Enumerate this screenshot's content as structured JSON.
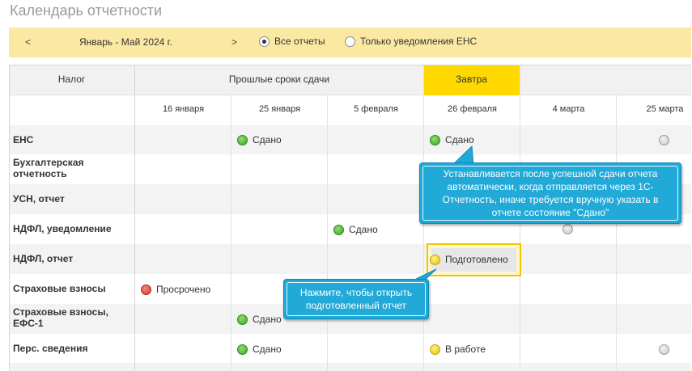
{
  "page": {
    "title": "Календарь отчетности"
  },
  "period": {
    "prev": "<",
    "label": "Январь - Май 2024 г.",
    "next": ">",
    "filter_all": "Все отчеты",
    "filter_ens": "Только уведомления ЕНС",
    "selected_filter": "Все отчеты"
  },
  "table": {
    "col_tax": "Налог",
    "col_past": "Прошлые сроки сдачи",
    "col_tomorrow": "Завтра",
    "dates": [
      "16 января",
      "25 января",
      "5 февраля",
      "26 февраля",
      "4 марта",
      "25 марта"
    ],
    "rows": [
      {
        "name": "ЕНС",
        "cells": [
          null,
          {
            "status": "green",
            "text": "Сдано"
          },
          null,
          {
            "status": "green",
            "text": "Сдано"
          },
          null,
          {
            "status": "gray",
            "text": ""
          }
        ]
      },
      {
        "name": "Бухгалтерская отчетность",
        "cells": [
          null,
          null,
          null,
          null,
          null,
          null
        ]
      },
      {
        "name": "УСН, отчет",
        "cells": [
          null,
          null,
          null,
          null,
          null,
          null
        ]
      },
      {
        "name": "НДФЛ, уведомление",
        "cells": [
          null,
          null,
          {
            "status": "green",
            "text": "Сдано"
          },
          null,
          {
            "status": "gray",
            "text": ""
          },
          null
        ]
      },
      {
        "name": "НДФЛ, отчет",
        "cells": [
          null,
          null,
          null,
          {
            "status": "yellow",
            "text": "Подготовлено"
          },
          null,
          null
        ]
      },
      {
        "name": "Страховые взносы",
        "cells": [
          {
            "status": "red",
            "text": "Просрочено"
          },
          null,
          null,
          null,
          null,
          null
        ]
      },
      {
        "name": "Страховые взносы, ЕФС-1",
        "cells": [
          null,
          {
            "status": "green",
            "text": "Сдано"
          },
          null,
          null,
          null,
          null
        ]
      },
      {
        "name": "Перс. сведения",
        "cells": [
          null,
          {
            "status": "green",
            "text": "Сдано"
          },
          null,
          {
            "status": "yellow",
            "text": "В работе"
          },
          null,
          {
            "status": "gray",
            "text": ""
          }
        ]
      }
    ]
  },
  "callouts": {
    "submitted_hint": "Устанавливается после успешной сдачи отчета автоматически, когда отправляется через 1С-Отчетность, иначе требуется вручную указать в отчете состояние \"Сдано\"",
    "prepared_hint": "Нажмите, чтобы открыть подготовленный отчет"
  },
  "colors": {
    "period_bar": "#fbe9a3",
    "tomorrow": "#ffd800",
    "callout": "#1ea9d8",
    "status_green": "#3ca32a",
    "status_red": "#d23a2a",
    "status_yellow": "#e2c200",
    "status_gray": "#c6c6c6"
  }
}
